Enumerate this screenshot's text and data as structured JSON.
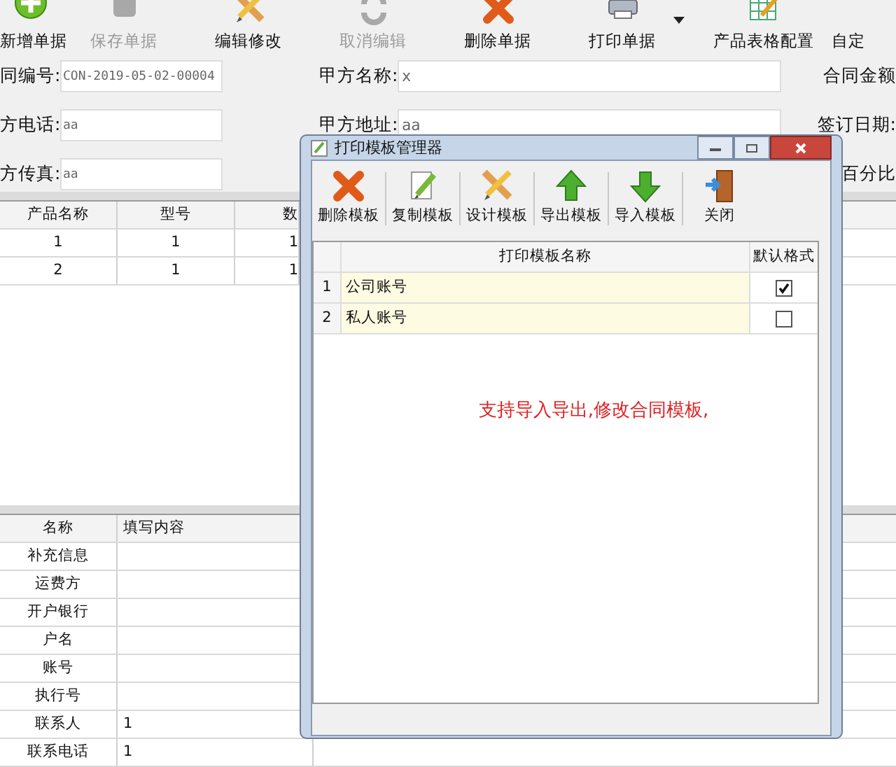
{
  "toolbar": [
    {
      "label": "新增单据",
      "kind": "add",
      "disabled": false
    },
    {
      "label": "保存单据",
      "kind": "save",
      "disabled": true
    },
    {
      "label": "编辑修改",
      "kind": "edit",
      "disabled": false
    },
    {
      "label": "取消编辑",
      "kind": "undo",
      "disabled": true
    },
    {
      "label": "删除单据",
      "kind": "delete",
      "disabled": false
    },
    {
      "label": "打印单据",
      "kind": "print",
      "disabled": false
    },
    {
      "kind": "dropdown"
    },
    {
      "label": "产品表格配置",
      "kind": "grid",
      "disabled": false
    },
    {
      "label": "自定",
      "kind": "plain"
    }
  ],
  "form": {
    "left": [
      {
        "label": "同编号:",
        "value": "CON-2019-05-02-00004"
      },
      {
        "label": "方电话:",
        "value": "aa"
      },
      {
        "label": "方传真:",
        "value": "aa"
      }
    ],
    "middle": [
      {
        "label": "甲方名称:",
        "value": "x"
      },
      {
        "label": "甲方地址:",
        "value": "aa"
      }
    ],
    "right": [
      {
        "label": "合同金额"
      },
      {
        "label": "签订日期:"
      },
      {
        "label": "百分比"
      }
    ]
  },
  "products": {
    "columns": [
      "产品名称",
      "型号",
      "数"
    ],
    "rows": [
      [
        "1",
        "1",
        "1"
      ],
      [
        "2",
        "1",
        "1"
      ]
    ]
  },
  "details": {
    "columns": [
      "名称",
      "填写内容"
    ],
    "rows": [
      {
        "name": "补充信息"
      },
      {
        "name": "运费方"
      },
      {
        "name": "开户银行"
      },
      {
        "name": "户名"
      },
      {
        "name": "账号"
      },
      {
        "name": "执行号"
      },
      {
        "name": "联系人",
        "value": "1"
      },
      {
        "name": "联系电话",
        "value": "1"
      }
    ]
  },
  "dialog": {
    "title": "打印模板管理器",
    "toolbar": [
      {
        "label": "删除模板",
        "kind": "delete"
      },
      {
        "label": "复制模板",
        "kind": "copy"
      },
      {
        "label": "设计模板",
        "kind": "design"
      },
      {
        "label": "导出模板",
        "kind": "export"
      },
      {
        "label": "导入模板",
        "kind": "import"
      },
      {
        "label": "关闭",
        "kind": "exit"
      }
    ],
    "columns": [
      "打印模板名称",
      "默认格式"
    ],
    "rows": [
      {
        "index": "1",
        "name": "公司账号",
        "default": true
      },
      {
        "index": "2",
        "name": "私人账号",
        "default": false
      }
    ],
    "note": "支持导入导出,修改合同模板,"
  }
}
